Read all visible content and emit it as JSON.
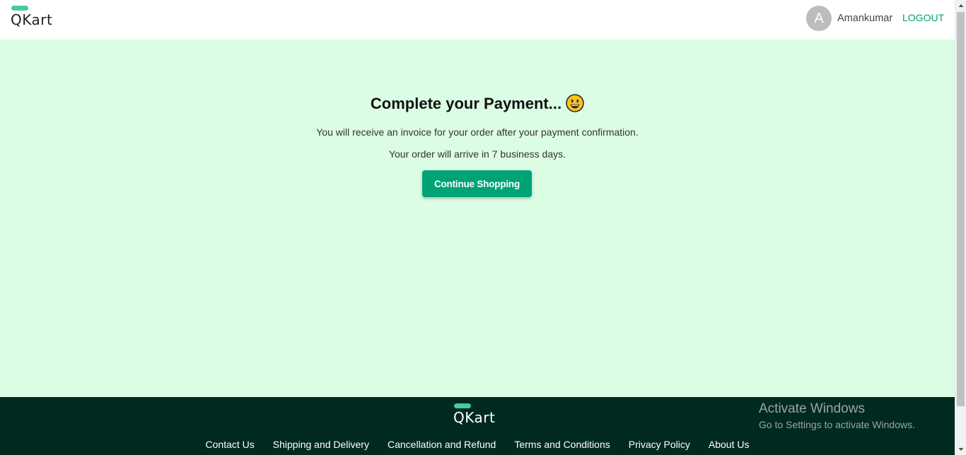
{
  "header": {
    "logo_text": "QKart",
    "avatar_initial": "A",
    "username": "Amankumar",
    "logout_label": "LOGOUT"
  },
  "main": {
    "title": "Complete your Payment...",
    "title_emoji_icon": "grinning-face-emoji",
    "invoice_text": "You will receive an invoice for your order after your payment confirmation.",
    "arrival_text": "Your order will arrive in 7 business days.",
    "continue_button_label": "Continue Shopping"
  },
  "footer": {
    "logo_text": "QKart",
    "links": [
      "Contact Us",
      "Shipping and Delivery",
      "Cancellation and Refund",
      "Terms and Conditions",
      "Privacy Policy",
      "About Us"
    ]
  },
  "watermark": {
    "title": "Activate Windows",
    "subtitle": "Go to Settings to activate Windows."
  },
  "colors": {
    "accent": "#00a278",
    "logo_accent": "#47c9a2",
    "main_background": "#dbfde3",
    "footer_background": "#002a20",
    "avatar_background": "#bdbdbd"
  }
}
